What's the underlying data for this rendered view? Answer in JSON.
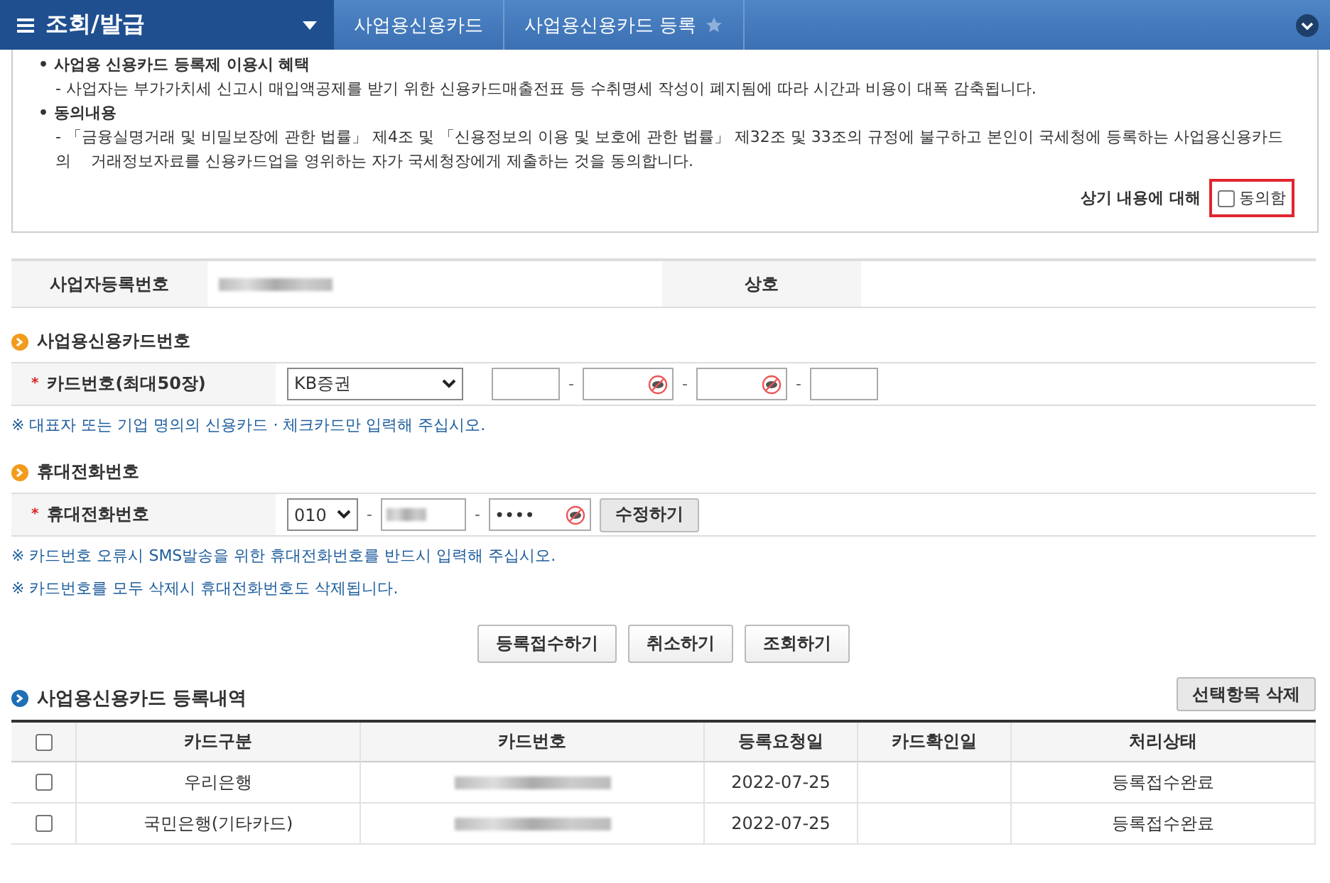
{
  "header": {
    "title": "조회/발급",
    "breadcrumbs": [
      "사업용신용카드",
      "사업용신용카드 등록"
    ]
  },
  "marks": {
    "bullet": "•",
    "required": "*",
    "separator": "-"
  },
  "notice": {
    "sections": [
      {
        "heading": "사업용 신용카드 등록제 이용시 혜택",
        "text": "- 사업자는 부가가치세 신고시 매입액공제를 받기 위한 신용카드매출전표 등 수취명세 작성이 폐지됨에 따라 시간과 비용이 대폭 감축됩니다."
      },
      {
        "heading": "동의내용",
        "text": "- 「금융실명거래 및 비밀보장에 관한 법률」 제4조 및 「신용정보의 이용 및 보호에 관한 법률」 제32조 및 33조의 규정에 불구하고 본인이 국세청에 등록하는 사업용신용카드의    거래정보자료를 신용카드업을 영위하는 자가 국세청장에게 제출하는 것을 동의합니다."
      }
    ],
    "agree_prompt": "상기 내용에 대해",
    "agree_label": "동의함",
    "agree_checked": false
  },
  "business": {
    "number_label": "사업자등록번호",
    "name_label": "상호"
  },
  "card": {
    "title": "사업용신용카드번호",
    "label": "카드번호(최대50장)",
    "company": "KB증권",
    "note": "※ 대표자 또는 기업 명의의 신용카드 · 체크카드만 입력해 주십시오."
  },
  "phone": {
    "title": "휴대전화번호",
    "label": "휴대전화번호",
    "prefix": "010",
    "last": "••••",
    "edit_button": "수정하기",
    "notes": [
      "※ 카드번호 오류시 SMS발송을 위한 휴대전화번호를 반드시 입력해 주십시오.",
      "※ 카드번호를 모두 삭제시 휴대전화번호도 삭제됩니다."
    ]
  },
  "actions": [
    "등록접수하기",
    "취소하기",
    "조회하기"
  ],
  "list": {
    "title": "사업용신용카드 등록내역",
    "delete_button": "선택항목 삭제",
    "all_checked": false,
    "columns": [
      "카드구분",
      "카드번호",
      "등록요청일",
      "카드확인일",
      "처리상태"
    ],
    "rows": [
      {
        "checked": false,
        "company": "우리은행",
        "date": "2022-07-25",
        "status": "등록접수완료"
      },
      {
        "checked": false,
        "company": "국민은행(기타카드)",
        "date": "2022-07-25",
        "status": "등록접수완료"
      }
    ]
  }
}
